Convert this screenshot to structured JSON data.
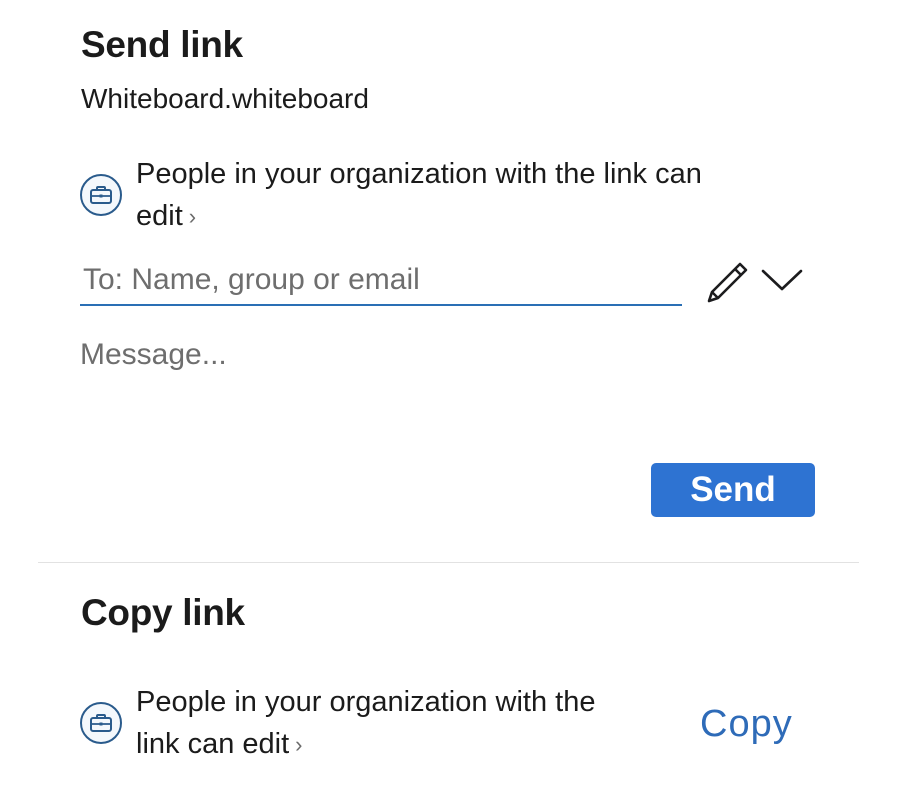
{
  "send_section": {
    "title": "Send link",
    "file_name": "Whiteboard.whiteboard",
    "permission": {
      "text": "People in your organization with the link can edit",
      "icon": "briefcase-icon",
      "chevron": "›"
    },
    "to_field": {
      "placeholder": "To: Name, group or email",
      "value": ""
    },
    "permission_icon": "pencil-icon",
    "dropdown_icon": "chevron-down-icon",
    "message_field": {
      "placeholder": "Message...",
      "value": ""
    },
    "send_label": "Send"
  },
  "copy_section": {
    "title": "Copy link",
    "permission": {
      "text_line1": "People in your organization with the",
      "text_line2": "link can edit",
      "icon": "briefcase-icon",
      "chevron": "›"
    },
    "copy_label": "Copy"
  },
  "colors": {
    "accent": "#2e73d2",
    "link": "#2e6bb8",
    "icon_stroke": "#2a5b8c",
    "field_underline": "#2a6fb5"
  }
}
